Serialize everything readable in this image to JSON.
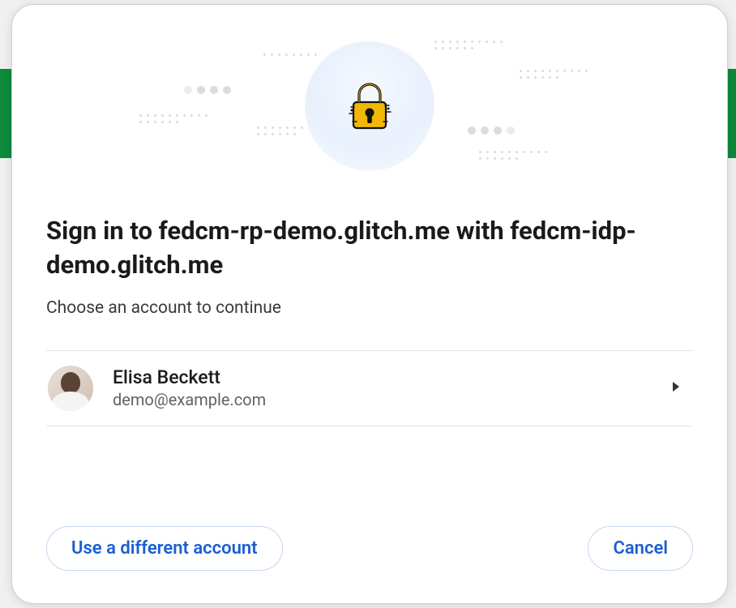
{
  "dialog": {
    "title": "Sign in to fedcm-rp-demo.glitch.me with fedcm-idp-demo.glitch.me",
    "subtitle": "Choose an account to continue"
  },
  "accounts": [
    {
      "name": "Elisa Beckett",
      "email": "demo@example.com"
    }
  ],
  "buttons": {
    "use_different": "Use a different account",
    "cancel": "Cancel"
  }
}
